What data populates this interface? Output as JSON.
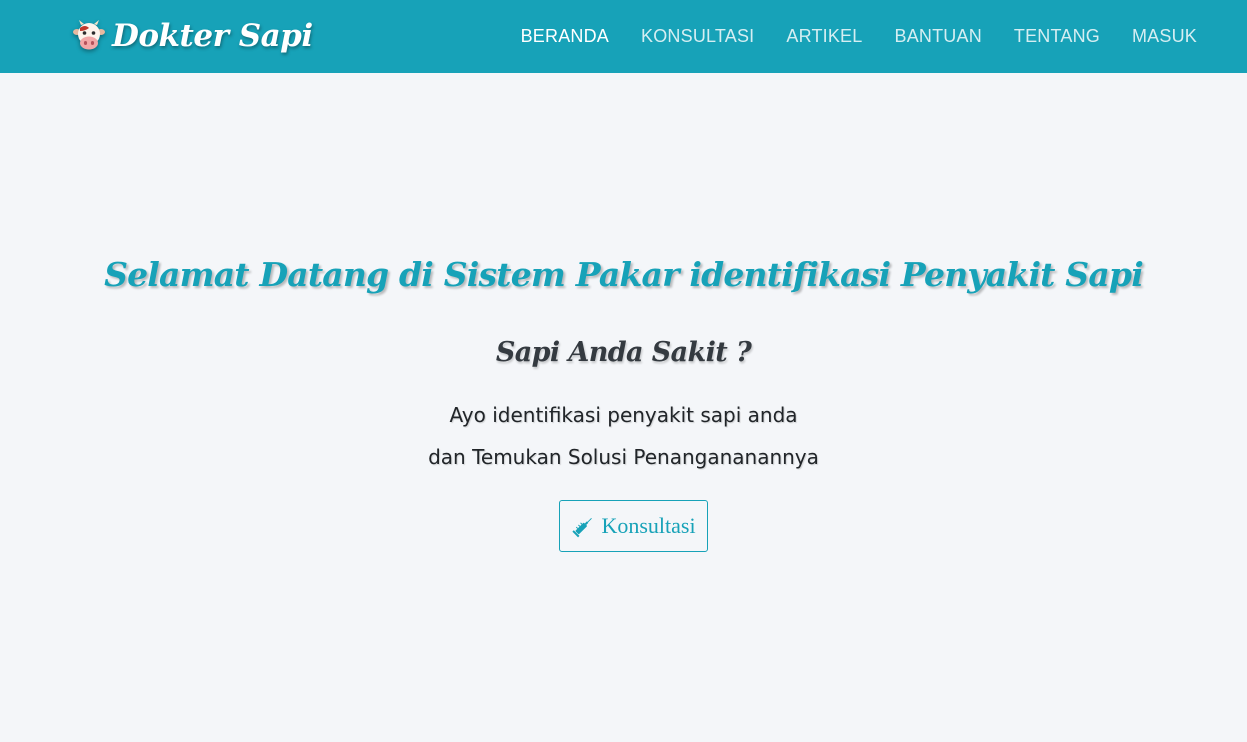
{
  "brand": {
    "name": "Dokter Sapi",
    "logo_icon": "cow-face-icon"
  },
  "nav": {
    "items": [
      {
        "label": "BERANDA",
        "active": true
      },
      {
        "label": "KONSULTASI",
        "active": false
      },
      {
        "label": "ARTIKEL",
        "active": false
      },
      {
        "label": "BANTUAN",
        "active": false
      },
      {
        "label": "TENTANG",
        "active": false
      },
      {
        "label": "MASUK",
        "active": false
      }
    ]
  },
  "hero": {
    "title": "Selamat Datang di Sistem Pakar identifikasi Penyakit Sapi",
    "subtitle": "Sapi Anda Sakit ?",
    "line1": "Ayo identifikasi penyakit sapi anda",
    "line2": "dan Temukan Solusi Penangananannya",
    "cta_label": "Konsultasi",
    "cta_icon": "syringe-icon"
  },
  "colors": {
    "primary": "#17a2b8",
    "background": "#f4f6f9",
    "heading_dark": "#343a40"
  }
}
